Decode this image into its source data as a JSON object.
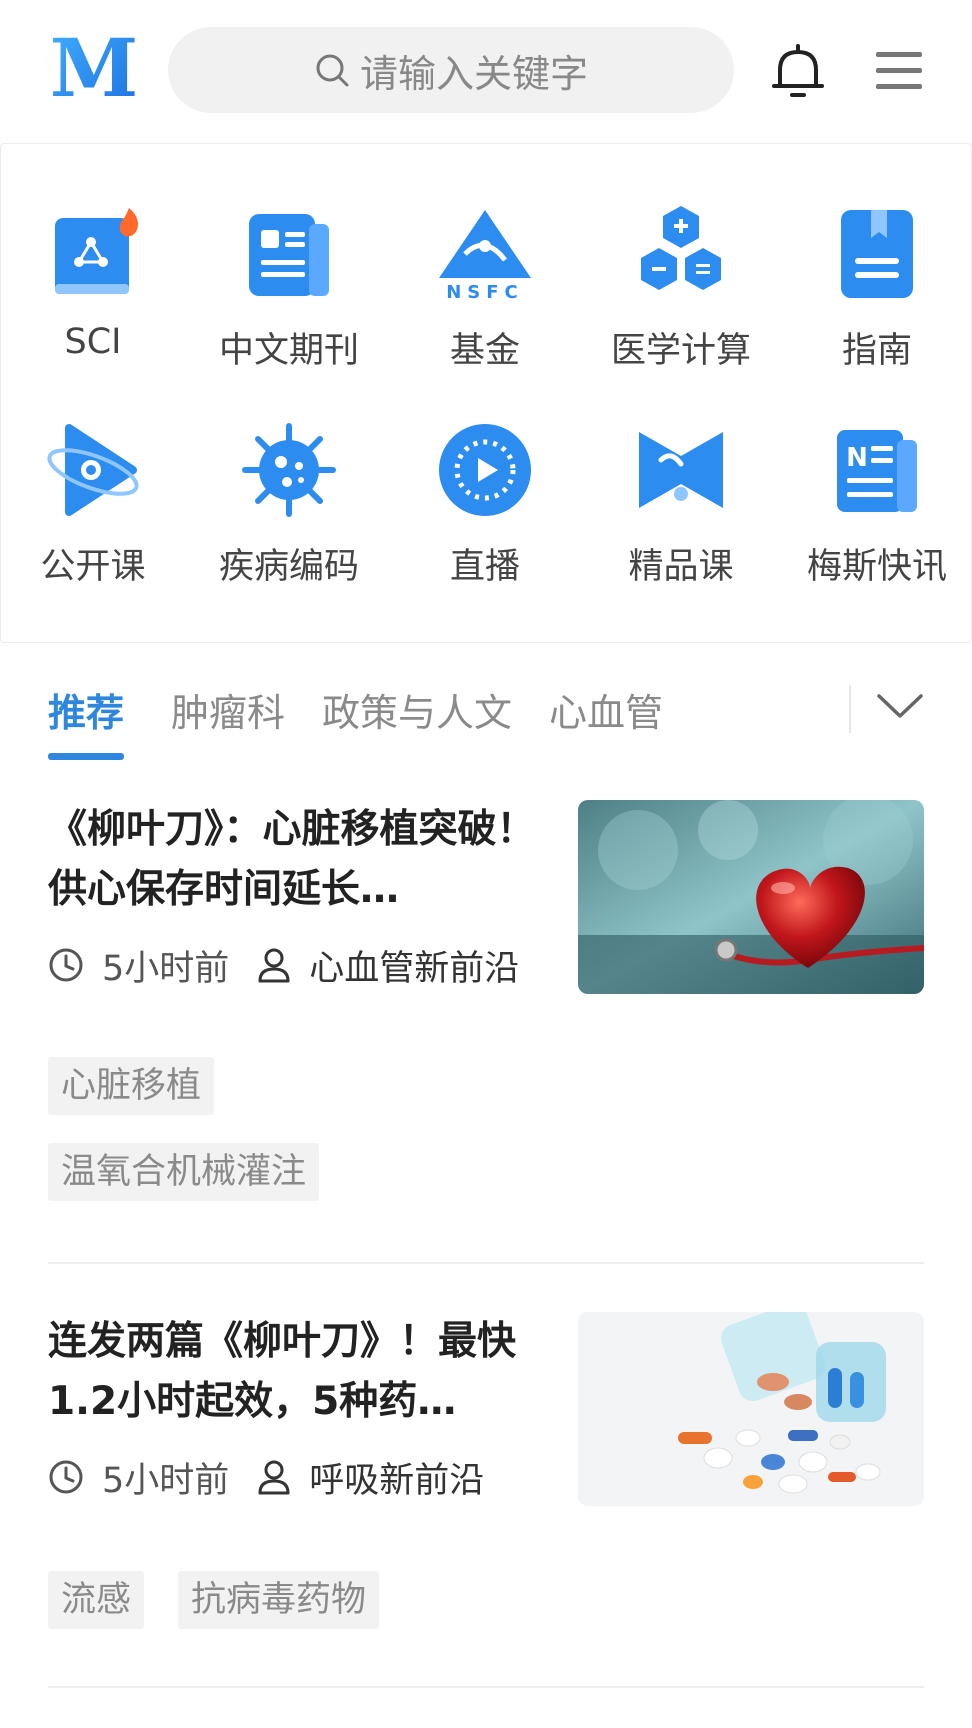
{
  "header": {
    "logo_text": "M",
    "search_placeholder": "请输入关键字",
    "bell_icon": "bell-icon",
    "menu_icon": "menu-icon"
  },
  "nav_grid": [
    {
      "label": "SCI",
      "icon": "sci-book-icon"
    },
    {
      "label": "中文期刊",
      "icon": "journal-icon"
    },
    {
      "label": "基金",
      "icon": "nsfc-icon"
    },
    {
      "label": "医学计算",
      "icon": "calculator-icon"
    },
    {
      "label": "指南",
      "icon": "guide-icon"
    },
    {
      "label": "公开课",
      "icon": "open-course-icon"
    },
    {
      "label": "疾病编码",
      "icon": "virus-icon"
    },
    {
      "label": "直播",
      "icon": "live-icon"
    },
    {
      "label": "精品课",
      "icon": "premium-course-icon"
    },
    {
      "label": "梅斯快讯",
      "icon": "news-icon"
    }
  ],
  "nsfc_text": "NSFC",
  "tabs": [
    {
      "label": "推荐",
      "active": true
    },
    {
      "label": "肿瘤科",
      "active": false
    },
    {
      "label": "政策与人文",
      "active": false
    },
    {
      "label": "心血管",
      "active": false
    }
  ],
  "articles": [
    {
      "title": "《柳叶刀》：心脏移植突破！供心保存时间延长…",
      "time": "5小时前",
      "author": "心血管新前沿",
      "tags": [
        "心脏移植",
        "温氧合机械灌注"
      ],
      "thumb": "heart-stethoscope-image"
    },
    {
      "title": "连发两篇《柳叶刀》！最快1.2小时起效，5种药…",
      "time": "5小时前",
      "author": "呼吸新前沿",
      "tags": [
        "流感",
        "抗病毒药物"
      ],
      "thumb": "pills-bottle-image"
    }
  ],
  "colors": {
    "accent": "#2e86de",
    "icon_blue": "#2d8cf0",
    "tag_bg": "#f2f2f2",
    "search_bg": "#f1f1f1"
  }
}
